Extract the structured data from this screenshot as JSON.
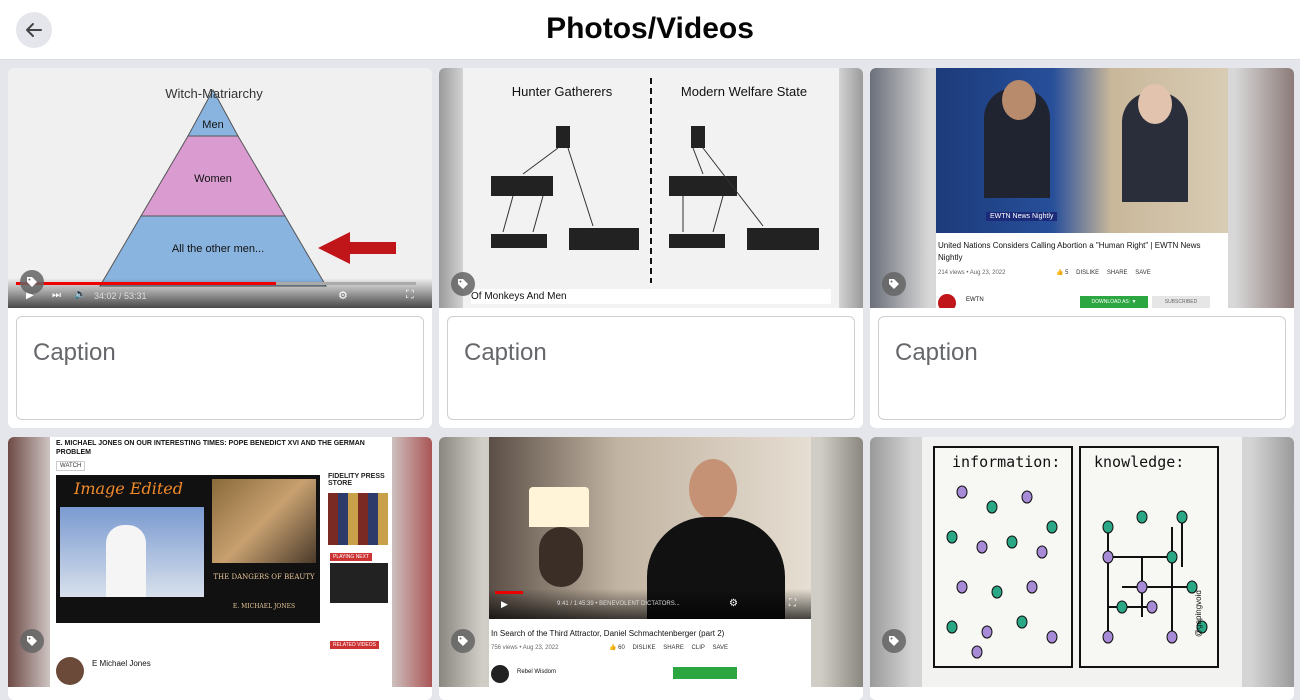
{
  "header": {
    "title": "Photos/Videos",
    "back_icon": "arrow-left-icon"
  },
  "caption_placeholder": "Caption",
  "cards": [
    {
      "kind": "video-slide",
      "slide_title": "Witch-Matriarchy",
      "tiers": [
        "Men",
        "Women",
        "All the other men..."
      ],
      "time": "34:02 / 53:31"
    },
    {
      "kind": "diagram",
      "left_title": "Hunter Gatherers",
      "right_title": "Modern Welfare State",
      "footer": "Of Monkeys And Men"
    },
    {
      "kind": "news",
      "badge": "EWTN News Nightly",
      "video_title": "United Nations Considers Calling Abortion a \"Human Right\" | EWTN News Nightly",
      "meta": "214 views • Aug 23, 2022",
      "likes": "5",
      "dislike": "DISLIKE",
      "share": "SHARE",
      "save": "SAVE",
      "channel": "EWTN",
      "download": "DOWNLOAD AS: ▼",
      "subscribed": "SUBSCRIBED"
    },
    {
      "kind": "webpage",
      "heading": "E. MICHAEL JONES ON OUR INTERESTING TIMES: POPE BENEDICT XVI AND THE GERMAN PROBLEM",
      "watch": "WATCH",
      "edited": "Image Edited",
      "book_title": "THE DANGERS OF BEAUTY",
      "author": "E. MICHAEL JONES",
      "playing_next": "PLAYING NEXT",
      "related": "RELATED VIDEOS",
      "channel": "E Michael Jones",
      "press": "FIDELITY PRESS STORE"
    },
    {
      "kind": "video",
      "time": "9:41 / 1:45:39 • BENEVOLENT DICTATORS...",
      "video_title": "In Search of the Third Attractor, Daniel Schmachtenberger (part 2)",
      "meta": "756 views • Aug 23, 2022",
      "likes": "60",
      "dislike": "DISLIKE",
      "share": "SHARE",
      "clip": "CLIP",
      "save": "SAVE",
      "channel": "Rebel Wisdom"
    },
    {
      "kind": "sketch",
      "left_title": "information:",
      "right_title": "knowledge:",
      "signature": "@gapingvoid"
    }
  ],
  "colors": {
    "pyramid_top": "#8ab4e0",
    "pyramid_mid": "#d99bd0",
    "pyramid_bottom": "#8ab4e0",
    "arrow": "#c0161a",
    "accent_green": "#2ba640",
    "dot_purple": "#a78bd6",
    "dot_teal": "#2aa886"
  }
}
